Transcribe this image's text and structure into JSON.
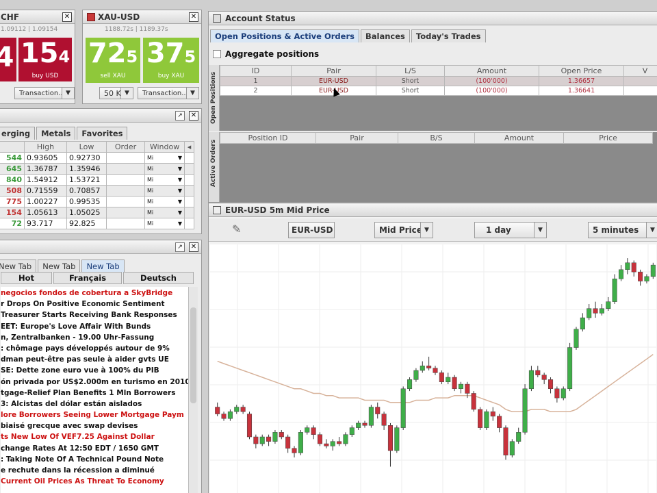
{
  "usdchf": {
    "title": "CHF",
    "sub": "1.09112 | 1.09154",
    "sell_big": "4",
    "buy_big": "15",
    "buy_small": "4",
    "buy_label": "buy USD",
    "transaction": "Transaction...",
    "sell_color": "#b01030",
    "buy_color": "#b01030"
  },
  "xauusd": {
    "title": "XAU-USD",
    "sub": "1188.72s | 1189.37s",
    "sell_big": "72",
    "sell_small": "5",
    "buy_big": "37",
    "buy_small": "5",
    "sell_label": "sell XAU",
    "buy_label": "buy XAU",
    "amount": "50 K",
    "transaction": "Transaction...",
    "tile_color": "#8fc83a"
  },
  "watchlist": {
    "tabs": [
      "erging",
      "Metals",
      "Favorites"
    ],
    "headers": [
      "",
      "High",
      "Low",
      "Order",
      "Window"
    ],
    "rows": [
      {
        "cur": "544",
        "high": "0.93605",
        "low": "0.92730",
        "win": "Mi"
      },
      {
        "cur": "645",
        "high": "1.36787",
        "low": "1.35946",
        "win": "Mi"
      },
      {
        "cur": "840",
        "high": "1.54912",
        "low": "1.53721",
        "win": "Mi"
      },
      {
        "cur": "508",
        "high": "0.71559",
        "low": "0.70857",
        "win": "Mi"
      },
      {
        "cur": "775",
        "high": "1.00227",
        "low": "0.99535",
        "win": "Mi"
      },
      {
        "cur": "154",
        "high": "1.05613",
        "low": "1.05025",
        "win": "Mi"
      },
      {
        "cur": "72",
        "high": "93.717",
        "low": "92.825",
        "win": "Mi"
      }
    ]
  },
  "news": {
    "tabs": [
      "New Tab",
      "New Tab",
      "New Tab"
    ],
    "langs": [
      "Hot",
      "Français",
      "Deutsch"
    ],
    "lines": [
      {
        "t": "negocios fondos de cobertura a SkyBridge",
        "red": true
      },
      {
        "t": "r Drops On Positive Economic Sentiment",
        "red": false
      },
      {
        "t": "Treasurer Starts Receiving Bank Responses",
        "red": false
      },
      {
        "t": "EET: Europe's Love Affair With Bunds",
        "red": false
      },
      {
        "t": "n, Zentralbanken - 19.00 Uhr-Fassung",
        "red": false
      },
      {
        "t": ": chômage pays développés autour de 9%",
        "red": false
      },
      {
        "t": "dman peut-être pas seule à aider gvts UE",
        "red": false
      },
      {
        "t": "SE: Dette zone euro vue à 100% du PIB",
        "red": false
      },
      {
        "t": "ón privada por US$2.000m en turismo en 2010",
        "red": false
      },
      {
        "t": "tgage-Relief Plan Benefits 1 Mln Borrowers",
        "red": false
      },
      {
        "t": "3: Alcistas del dólar están aislados",
        "red": false
      },
      {
        "t": "lore Borrowers Seeing Lower Mortgage Paym",
        "red": true
      },
      {
        "t": "biaisé grecque avec swap devises",
        "red": false
      },
      {
        "t": "ts New Low Of VEF7.25 Against Dollar",
        "red": true
      },
      {
        "t": "change Rates At 12:50 EDT / 1650 GMT",
        "red": false
      },
      {
        "t": ": Taking Note Of A Technical Pound Note",
        "red": false
      },
      {
        "t": "e rechute dans la récession a diminué",
        "red": false
      },
      {
        "t": "Current Oil Prices As Threat To Economy",
        "red": true
      }
    ]
  },
  "account": {
    "title": "Account Status",
    "tabs": [
      "Open Positions & Active Orders",
      "Balances",
      "Today's Trades"
    ],
    "aggregate": "Aggregate positions",
    "side_open": "Open Positions",
    "side_orders": "Active Orders",
    "pos_headers": [
      "ID",
      "Pair",
      "L/S",
      "Amount",
      "Open Price",
      "V"
    ],
    "positions": [
      {
        "id": "1",
        "pair": "EUR-USD",
        "ls": "Short",
        "amount": "(100'000)",
        "price": "1.36657"
      },
      {
        "id": "2",
        "pair": "EUR-USD",
        "ls": "Short",
        "amount": "(100'000)",
        "price": "1.36641"
      }
    ],
    "order_headers": [
      "Position ID",
      "Pair",
      "B/S",
      "Amount",
      "Price"
    ]
  },
  "chart": {
    "title": "EUR-USD 5m Mid Price",
    "pair": "EUR-USD",
    "price_type": "Mid Price",
    "range": "1 day",
    "interval": "5 minutes"
  },
  "chart_data": {
    "type": "candlestick",
    "candles": [
      [
        0.64,
        0.61,
        0.66,
        0.6
      ],
      [
        0.61,
        0.59,
        0.62,
        0.58
      ],
      [
        0.59,
        0.62,
        0.63,
        0.58
      ],
      [
        0.62,
        0.64,
        0.65,
        0.61
      ],
      [
        0.64,
        0.62,
        0.65,
        0.61
      ],
      [
        0.61,
        0.51,
        0.62,
        0.5
      ],
      [
        0.51,
        0.48,
        0.52,
        0.46
      ],
      [
        0.48,
        0.51,
        0.52,
        0.47
      ],
      [
        0.51,
        0.49,
        0.52,
        0.47
      ],
      [
        0.49,
        0.53,
        0.54,
        0.48
      ],
      [
        0.53,
        0.51,
        0.54,
        0.5
      ],
      [
        0.51,
        0.46,
        0.52,
        0.44
      ],
      [
        0.46,
        0.44,
        0.47,
        0.42
      ],
      [
        0.44,
        0.53,
        0.54,
        0.43
      ],
      [
        0.53,
        0.55,
        0.56,
        0.52
      ],
      [
        0.55,
        0.52,
        0.56,
        0.5
      ],
      [
        0.52,
        0.48,
        0.53,
        0.47
      ],
      [
        0.48,
        0.47,
        0.5,
        0.46
      ],
      [
        0.47,
        0.49,
        0.5,
        0.45
      ],
      [
        0.49,
        0.48,
        0.51,
        0.47
      ],
      [
        0.48,
        0.52,
        0.53,
        0.47
      ],
      [
        0.52,
        0.55,
        0.56,
        0.51
      ],
      [
        0.55,
        0.57,
        0.58,
        0.54
      ],
      [
        0.57,
        0.56,
        0.58,
        0.55
      ],
      [
        0.56,
        0.64,
        0.65,
        0.55
      ],
      [
        0.64,
        0.61,
        0.66,
        0.59
      ],
      [
        0.61,
        0.56,
        0.62,
        0.54
      ],
      [
        0.56,
        0.45,
        0.57,
        0.38
      ],
      [
        0.45,
        0.55,
        0.56,
        0.44
      ],
      [
        0.55,
        0.72,
        0.73,
        0.54
      ],
      [
        0.72,
        0.76,
        0.77,
        0.71
      ],
      [
        0.76,
        0.8,
        0.81,
        0.75
      ],
      [
        0.8,
        0.82,
        0.84,
        0.79
      ],
      [
        0.82,
        0.81,
        0.86,
        0.8
      ],
      [
        0.81,
        0.79,
        0.82,
        0.78
      ],
      [
        0.79,
        0.75,
        0.8,
        0.74
      ],
      [
        0.75,
        0.77,
        0.79,
        0.74
      ],
      [
        0.77,
        0.72,
        0.78,
        0.71
      ],
      [
        0.72,
        0.74,
        0.75,
        0.7
      ],
      [
        0.74,
        0.7,
        0.75,
        0.68
      ],
      [
        0.7,
        0.63,
        0.71,
        0.62
      ],
      [
        0.63,
        0.55,
        0.64,
        0.54
      ],
      [
        0.55,
        0.62,
        0.63,
        0.54
      ],
      [
        0.62,
        0.6,
        0.64,
        0.58
      ],
      [
        0.6,
        0.55,
        0.61,
        0.53
      ],
      [
        0.55,
        0.43,
        0.56,
        0.41
      ],
      [
        0.43,
        0.49,
        0.5,
        0.42
      ],
      [
        0.49,
        0.53,
        0.55,
        0.48
      ],
      [
        0.53,
        0.72,
        0.74,
        0.52
      ],
      [
        0.72,
        0.8,
        0.82,
        0.71
      ],
      [
        0.8,
        0.78,
        0.82,
        0.77
      ],
      [
        0.78,
        0.76,
        0.79,
        0.74
      ],
      [
        0.76,
        0.72,
        0.77,
        0.7
      ],
      [
        0.72,
        0.68,
        0.73,
        0.66
      ],
      [
        0.68,
        0.72,
        0.73,
        0.67
      ],
      [
        0.72,
        0.9,
        0.92,
        0.71
      ],
      [
        0.9,
        0.98,
        0.99,
        0.89
      ],
      [
        0.98,
        1.03,
        1.05,
        0.97
      ],
      [
        1.03,
        1.07,
        1.09,
        1.02
      ],
      [
        1.07,
        1.05,
        1.1,
        1.03
      ],
      [
        1.05,
        1.07,
        1.09,
        1.04
      ],
      [
        1.07,
        1.1,
        1.12,
        1.06
      ],
      [
        1.1,
        1.2,
        1.22,
        1.09
      ],
      [
        1.2,
        1.24,
        1.26,
        1.19
      ],
      [
        1.24,
        1.27,
        1.29,
        1.22
      ],
      [
        1.27,
        1.23,
        1.28,
        1.21
      ],
      [
        1.23,
        1.19,
        1.24,
        1.17
      ],
      [
        1.19,
        1.21,
        1.22,
        1.18
      ],
      [
        1.21,
        1.26,
        1.27,
        1.2
      ]
    ],
    "ma": [
      0.84,
      0.83,
      0.82,
      0.81,
      0.8,
      0.79,
      0.78,
      0.77,
      0.76,
      0.75,
      0.74,
      0.73,
      0.72,
      0.72,
      0.71,
      0.7,
      0.7,
      0.69,
      0.69,
      0.68,
      0.68,
      0.68,
      0.68,
      0.67,
      0.67,
      0.67,
      0.67,
      0.66,
      0.66,
      0.66,
      0.66,
      0.67,
      0.67,
      0.67,
      0.68,
      0.68,
      0.68,
      0.69,
      0.69,
      0.69,
      0.69,
      0.68,
      0.67,
      0.66,
      0.65,
      0.63,
      0.62,
      0.62,
      0.62,
      0.63,
      0.63,
      0.63,
      0.62,
      0.62,
      0.62,
      0.62,
      0.63,
      0.65,
      0.67,
      0.69,
      0.71,
      0.73,
      0.75,
      0.77,
      0.79,
      0.81,
      0.83,
      0.85,
      0.87
    ],
    "colors": {
      "up": "#3fae49",
      "down": "#c8323c",
      "ma": "#d7b29a"
    }
  }
}
